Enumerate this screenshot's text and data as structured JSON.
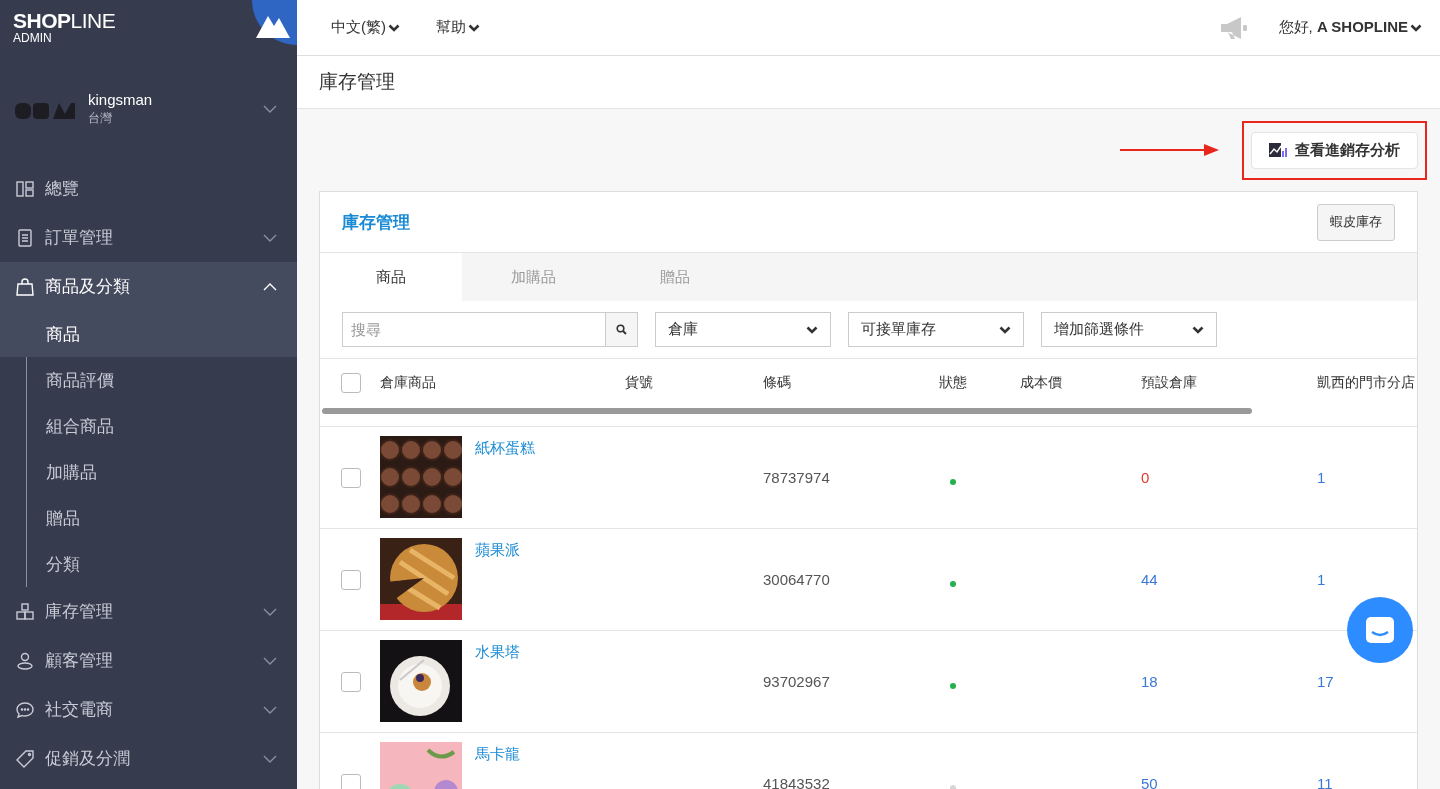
{
  "brand": {
    "logo": "**SHOP**LINE",
    "sub": "ADMIN"
  },
  "store": {
    "name": "kingsman",
    "region": "台灣"
  },
  "sidebar": {
    "items": [
      {
        "label": "總覽",
        "selected": false
      },
      {
        "label": "訂單管理",
        "expanded": false,
        "selected": false
      },
      {
        "label": "商品及分類",
        "expanded": true,
        "selected": true,
        "children": [
          {
            "label": "商品",
            "selected": true
          },
          {
            "label": "商品評價",
            "selected": false
          },
          {
            "label": "組合商品",
            "selected": false
          },
          {
            "label": "加購品",
            "selected": false
          },
          {
            "label": "贈品",
            "selected": false
          },
          {
            "label": "分類",
            "selected": false
          }
        ]
      },
      {
        "label": "庫存管理",
        "expanded": false,
        "selected": false
      },
      {
        "label": "顧客管理",
        "expanded": false,
        "selected": false
      },
      {
        "label": "社交電商",
        "expanded": false,
        "selected": false
      },
      {
        "label": "促銷及分潤",
        "expanded": false,
        "selected": false
      }
    ]
  },
  "topbar": {
    "menus": [
      "中文(繁)",
      "幫助"
    ],
    "greeting": "您好, **A SHOPLINE**"
  },
  "page_title": "庫存管理",
  "analysis_button": "查看進銷存分析",
  "card": {
    "title": "庫存管理",
    "shopee_button": "蝦皮庫存",
    "tabs": [
      {
        "label": "商品",
        "selected": true
      },
      {
        "label": "加購品",
        "selected": false
      },
      {
        "label": "贈品",
        "selected": false
      }
    ],
    "search": {
      "placeholder": "搜尋"
    },
    "filters": [
      "倉庫",
      "可接單庫存",
      "增加篩選條件"
    ],
    "table": {
      "select_all": {
        "checked": false
      },
      "columns": [
        "倉庫商品",
        "貨號",
        "條碼",
        "狀態",
        "成本價",
        "預設倉庫",
        "凱西的門市分店"
      ],
      "rows": [
        {
          "checked": false,
          "name": "紙杯蛋糕",
          "barcode": "78737974",
          "active": true,
          "default_stock": "0",
          "out_of_stock": true,
          "branch_stock": "1"
        },
        {
          "checked": false,
          "name": "蘋果派",
          "barcode": "30064770",
          "active": true,
          "default_stock": "44",
          "out_of_stock": false,
          "branch_stock": "1"
        },
        {
          "checked": false,
          "name": "水果塔",
          "barcode": "93702967",
          "active": true,
          "default_stock": "18",
          "out_of_stock": false,
          "branch_stock": "17"
        },
        {
          "checked": false,
          "name": "馬卡龍",
          "barcode": "41843532",
          "active": false,
          "default_stock": "50",
          "out_of_stock": false,
          "branch_stock": "11"
        }
      ]
    }
  }
}
